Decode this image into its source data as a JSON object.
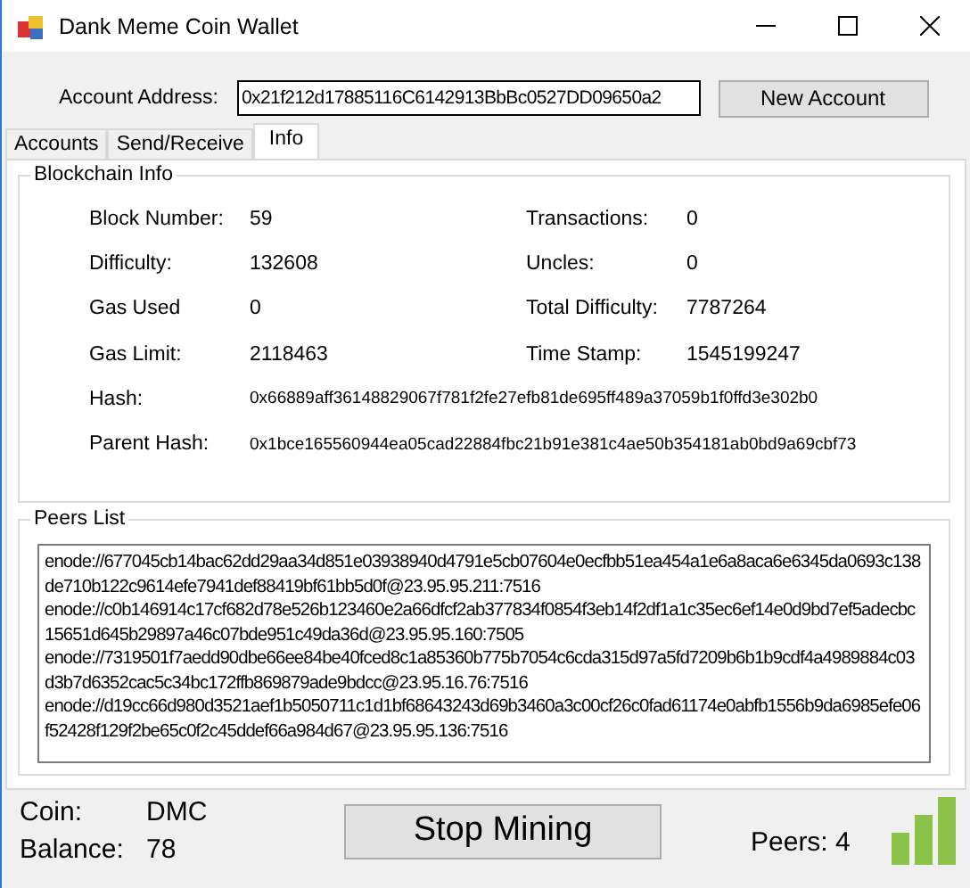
{
  "window": {
    "title": "Dank Meme Coin Wallet"
  },
  "account": {
    "label": "Account Address:",
    "value": "0x21f212d17885116C6142913BbBc0527DD09650a2",
    "button": "New Account"
  },
  "tabs": [
    {
      "label": "Accounts",
      "selected": false
    },
    {
      "label": "Send/Receive",
      "selected": false
    },
    {
      "label": "Info",
      "selected": true
    }
  ],
  "blockchain_info": {
    "title": "Blockchain Info",
    "fields": [
      {
        "label": "Block Number:",
        "value": "59"
      },
      {
        "label": "Transactions:",
        "value": "0"
      },
      {
        "label": "Difficulty:",
        "value": "132608"
      },
      {
        "label": "Uncles:",
        "value": "0"
      },
      {
        "label": "Gas Used",
        "value": "0"
      },
      {
        "label": "Total Difficulty:",
        "value": "7787264"
      },
      {
        "label": "Gas Limit:",
        "value": "2118463"
      },
      {
        "label": "Time Stamp:",
        "value": "1545199247"
      }
    ],
    "hashes": [
      {
        "label": "Hash:",
        "value": "0x66889aff36148829067f781f2fe27efb81de695ff489a37059b1f0ffd3e302b0"
      },
      {
        "label": "Parent Hash:",
        "value": "0x1bce165560944ea05cad22884fbc21b91e381c4ae50b354181ab0bd9a69cbf73"
      }
    ]
  },
  "peers_list": {
    "title": "Peers List",
    "peers": [
      "enode://677045cb14bac62dd29aa34d851e03938940d4791e5cb07604e0ecfbb51ea454a1e6a8aca6e6345da0693c138de710b122c9614efe7941def88419bf61bb5d0f@23.95.95.211:7516",
      "enode://c0b146914c17cf682d78e526b123460e2a66dfcf2ab377834f0854f3eb14f2df1a1c35ec6ef14e0d9bd7ef5adecbc15651d645b29897a46c07bde951c49da36d@23.95.95.160:7505",
      "enode://7319501f7aedd90dbe66ee84be40fced8c1a85360b775b7054c6cda315d97a5fd7209b6b1b9cdf4a4989884c03d3b7d6352cac5c34bc172ffb869879ade9bdcc@23.95.16.76:7516",
      "enode://d19cc66d980d3521aef1b5050711c1d1bf68643243d69b3460a3c00cf26c0fad61174e0abfb1556b9da6985efe06f52428f129f2be65c0f2c45ddef66a984d67@23.95.95.136:7516"
    ]
  },
  "status": {
    "coin_label": "Coin:",
    "coin": "DMC",
    "balance_label": "Balance:",
    "balance": "78",
    "button": "Stop Mining",
    "peers": "Peers: 4"
  }
}
